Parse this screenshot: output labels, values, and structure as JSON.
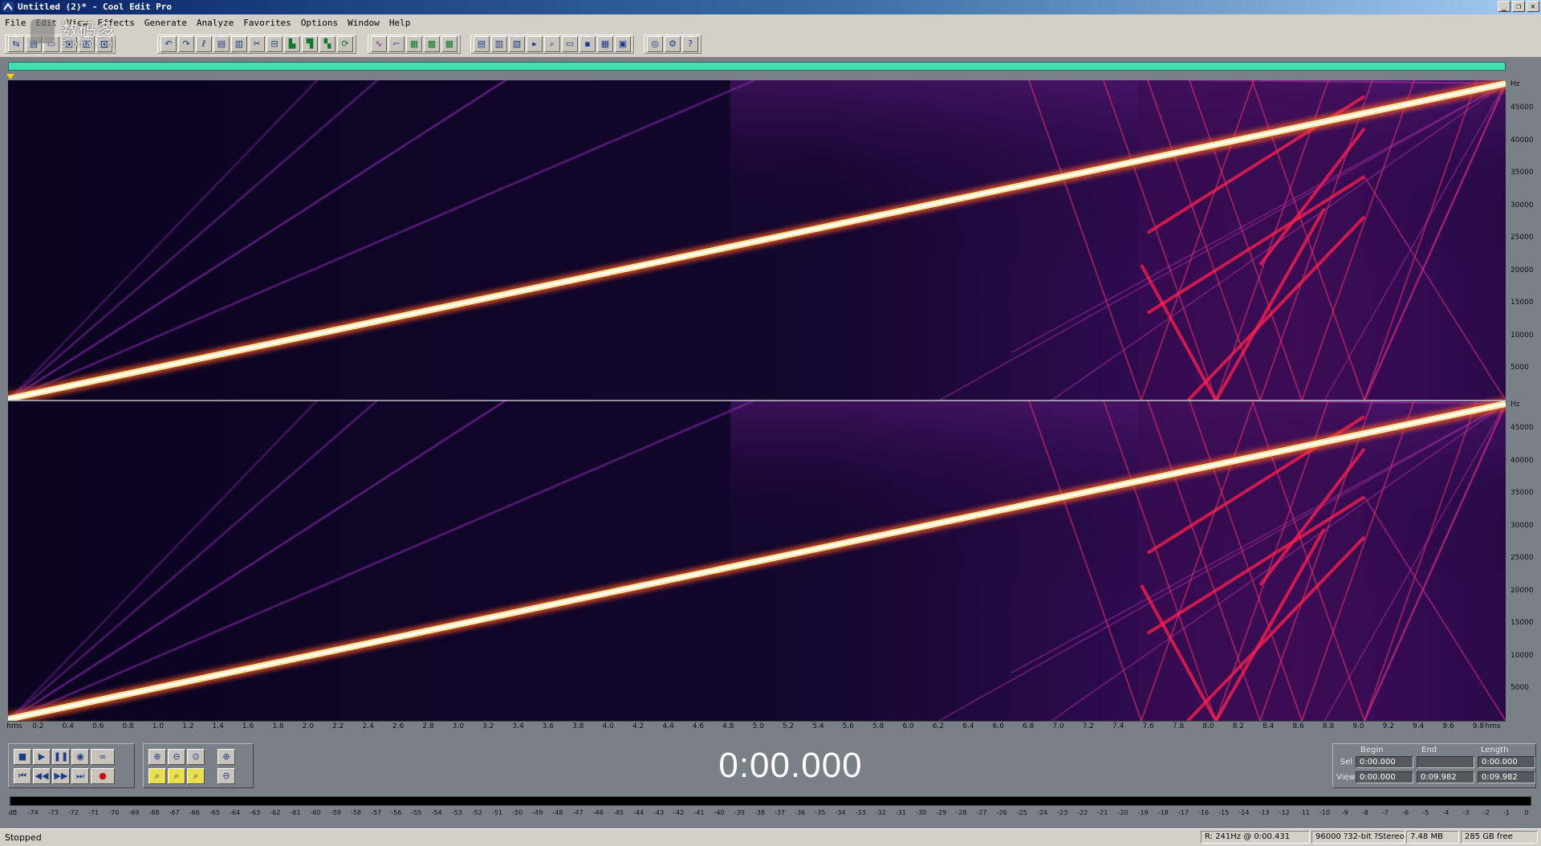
{
  "window": {
    "title": "Untitled (2)* - Cool Edit Pro",
    "controls": [
      "minimize",
      "restore",
      "close"
    ]
  },
  "watermark": {
    "text_cn": "数码多",
    "text_en": "Soomal.com"
  },
  "menu": [
    "File",
    "Edit",
    "View",
    "Effects",
    "Generate",
    "Analyze",
    "Favorites",
    "Options",
    "Window",
    "Help"
  ],
  "toolbar": {
    "groups": [
      [
        "mode-icon",
        "session-icon",
        "open-icon",
        "save-icon",
        "saveas-icon",
        "grid-icon"
      ],
      [
        "undo-icon",
        "redo-icon",
        "lasso-icon",
        "copy-icon",
        "paste-icon",
        "cut-icon",
        "trim-icon",
        "mix-icon",
        "amp-icon",
        "fx-icon",
        "loop-icon"
      ],
      [
        "waveform-icon",
        "envelope-icon",
        "stereo-icon",
        "spectral-icon",
        "meter-icon"
      ],
      [
        "snap-icon",
        "view-icon",
        "tool-icon",
        "play-sel-icon",
        "find-icon",
        "frame-icon",
        "smpte-icon",
        "bars-icon",
        "info-icon"
      ],
      [
        "cd-icon",
        "settings-icon",
        "help-icon"
      ]
    ]
  },
  "spectral": {
    "freq_unit": "Hz",
    "freq_ticks": [
      "45000",
      "40000",
      "35000",
      "30000",
      "25000",
      "20000",
      "15000",
      "10000",
      "5000"
    ],
    "time_unit_start": "hms",
    "time_unit_end": "hms",
    "time_ticks": [
      "0.2",
      "0.4",
      "0.6",
      "0.8",
      "1.0",
      "1.2",
      "1.4",
      "1.6",
      "1.8",
      "2.0",
      "2.2",
      "2.4",
      "2.6",
      "2.8",
      "3.0",
      "3.2",
      "3.4",
      "3.6",
      "3.8",
      "4.0",
      "4.2",
      "4.4",
      "4.6",
      "4.8",
      "5.0",
      "5.2",
      "5.4",
      "5.6",
      "5.8",
      "6.0",
      "6.2",
      "6.4",
      "6.6",
      "6.8",
      "7.0",
      "7.2",
      "7.4",
      "7.6",
      "7.8",
      "8.0",
      "8.2",
      "8.4",
      "8.6",
      "8.8",
      "9.0",
      "9.2",
      "9.4",
      "9.6",
      "9.8"
    ]
  },
  "transport": {
    "time_display": "0:00.000",
    "buttons": [
      "stop-icon",
      "play-icon",
      "pause-icon",
      "play-to-end-icon",
      "loop-icon",
      "go-start-icon",
      "rewind-icon",
      "fast-forward-icon",
      "go-end-icon",
      "record-icon"
    ],
    "zoom_buttons": [
      "zoom-in-horizontal-icon",
      "zoom-out-horizontal-icon",
      "zoom-full-icon",
      "zoom-in-vertical-icon",
      "zoom-in-left-icon",
      "zoom-in-right-icon",
      "zoom-selection-icon",
      "zoom-out-vertical-icon"
    ]
  },
  "selection": {
    "headers": {
      "begin": "Begin",
      "end": "End",
      "length": "Length"
    },
    "sel": {
      "label": "Sel",
      "begin": "0:00.000",
      "end": "",
      "length": "0:00.000"
    },
    "view": {
      "label": "View",
      "begin": "0:00.000",
      "end": "0:09.982",
      "length": "0:09.982"
    }
  },
  "level_meter": {
    "ticks": [
      "dB",
      "-74",
      "-73",
      "-72",
      "-71",
      "-70",
      "-69",
      "-68",
      "-67",
      "-66",
      "-65",
      "-64",
      "-63",
      "-62",
      "-61",
      "-60",
      "-59",
      "-58",
      "-57",
      "-56",
      "-55",
      "-54",
      "-53",
      "-52",
      "-51",
      "-50",
      "-49",
      "-48",
      "-47",
      "-46",
      "-45",
      "-44",
      "-43",
      "-42",
      "-41",
      "-40",
      "-39",
      "-38",
      "-37",
      "-36",
      "-35",
      "-34",
      "-33",
      "-32",
      "-31",
      "-30",
      "-29",
      "-28",
      "-27",
      "-26",
      "-25",
      "-24",
      "-23",
      "-22",
      "-21",
      "-20",
      "-19",
      "-18",
      "-17",
      "-16",
      "-15",
      "-14",
      "-13",
      "-12",
      "-11",
      "-10",
      "-9",
      "-8",
      "-7",
      "-6",
      "-5",
      "-4",
      "-3",
      "-2",
      "-1",
      "0"
    ]
  },
  "status": {
    "state": "Stopped",
    "cursor": "R: 241Hz @  0:00.431",
    "format": "96000 ?32-bit ?Stereo",
    "size": "7.48 MB",
    "free": "285 GB free"
  },
  "colors": {
    "accent_overview": "#40e0b0",
    "spectrum_bg": "#0b0420",
    "sweep": "#fff4c0",
    "alias": "#ff2050"
  }
}
